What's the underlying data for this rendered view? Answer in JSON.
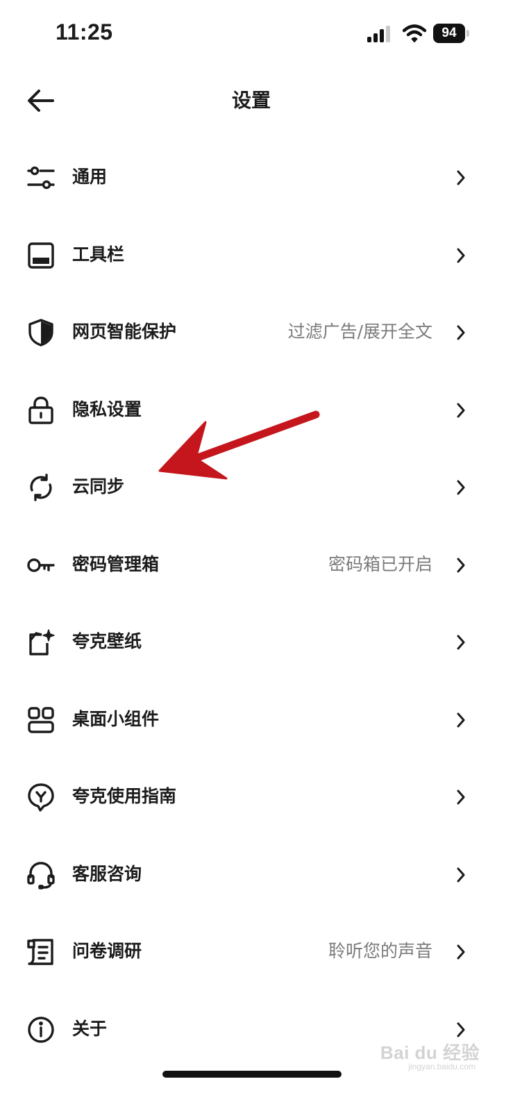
{
  "status_bar": {
    "time": "11:25",
    "battery": "94",
    "icons": [
      "signal-icon",
      "wifi-icon",
      "battery-icon"
    ]
  },
  "header": {
    "title": "设置",
    "back_icon": "arrow-left-icon"
  },
  "settings": [
    {
      "label": "通用",
      "value": "",
      "icon": "sliders-icon"
    },
    {
      "label": "工具栏",
      "value": "",
      "icon": "toolbar-icon"
    },
    {
      "label": "网页智能保护",
      "value": "过滤广告/展开全文",
      "icon": "shield-icon"
    },
    {
      "label": "隐私设置",
      "value": "",
      "icon": "lock-icon"
    },
    {
      "label": "云同步",
      "value": "",
      "icon": "sync-icon"
    },
    {
      "label": "密码管理箱",
      "value": "密码箱已开启",
      "icon": "key-icon"
    },
    {
      "label": "夸克壁纸",
      "value": "",
      "icon": "wallpaper-icon"
    },
    {
      "label": "桌面小组件",
      "value": "",
      "icon": "widgets-icon"
    },
    {
      "label": "夸克使用指南",
      "value": "",
      "icon": "guide-icon"
    },
    {
      "label": "客服咨询",
      "value": "",
      "icon": "headset-icon"
    },
    {
      "label": "问卷调研",
      "value": "聆听您的声音",
      "icon": "survey-icon"
    },
    {
      "label": "关于",
      "value": "",
      "icon": "info-icon"
    }
  ],
  "watermark": {
    "text": "Bai du 经验",
    "sub": "jingyan.baidu.com"
  },
  "colors": {
    "text": "#1b1b1b",
    "secondary_text": "#7a7a7a",
    "annotation_arrow": "#c4161c",
    "background": "#ffffff"
  }
}
